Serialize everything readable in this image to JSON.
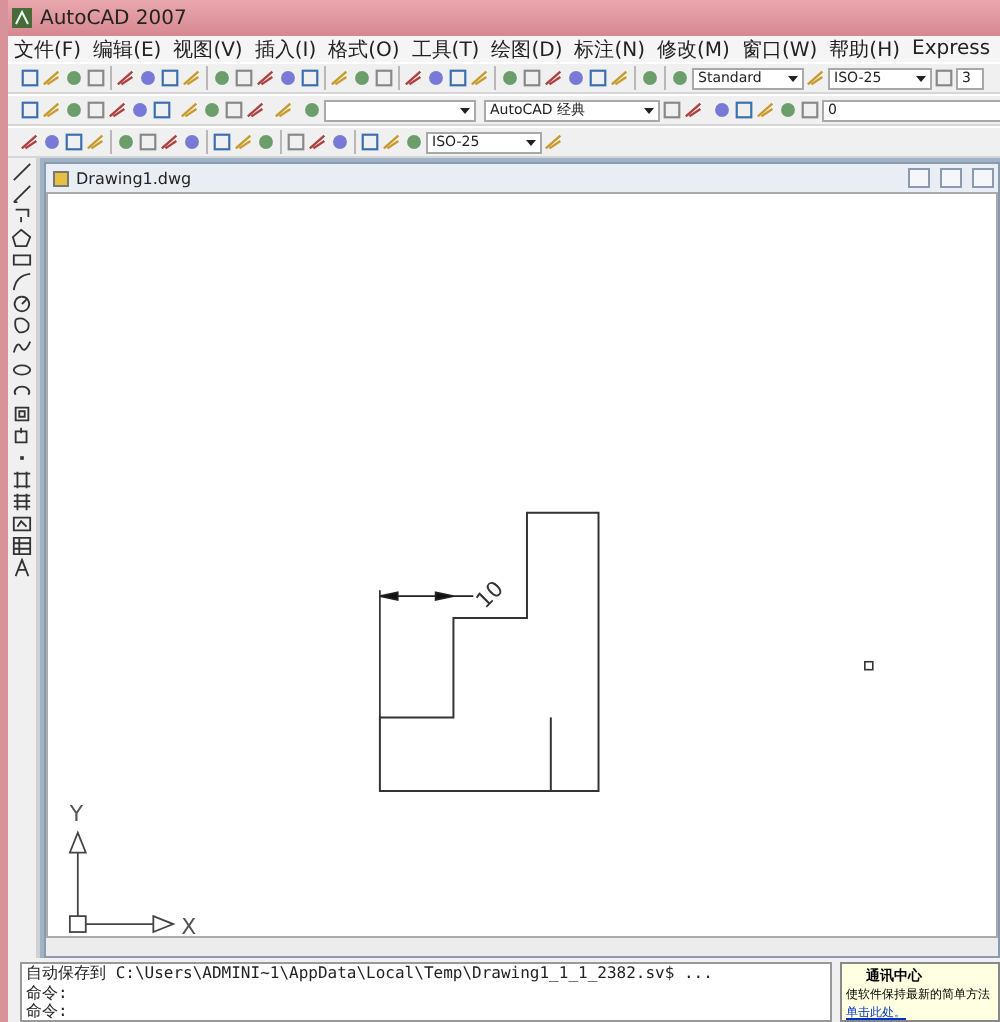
{
  "window": {
    "title": "AutoCAD 2007"
  },
  "menu": [
    "文件(F)",
    "编辑(E)",
    "视图(V)",
    "插入(I)",
    "格式(O)",
    "工具(T)",
    "绘图(D)",
    "标注(N)",
    "修改(M)",
    "窗口(W)",
    "帮助(H)",
    "Express"
  ],
  "toolbars": {
    "text_style": "Standard",
    "dim_style": "ISO-25",
    "table_style": "3",
    "workspace": "AutoCAD 经典",
    "layer": "0",
    "dimension_style": "ISO-25"
  },
  "document": {
    "title": "Drawing1.dwg"
  },
  "drawing": {
    "dimension": "10",
    "x_label": "X",
    "y_label": "Y"
  },
  "command_lines": [
    "自动保存到 C:\\Users\\ADMINI~1\\AppData\\Local\\Temp\\Drawing1_1_1_2382.sv$ ...",
    "命令:",
    "命令:"
  ],
  "notification": {
    "title": "通讯中心",
    "message": "使软件保持最新的简单方法",
    "link": "单击此处。"
  }
}
